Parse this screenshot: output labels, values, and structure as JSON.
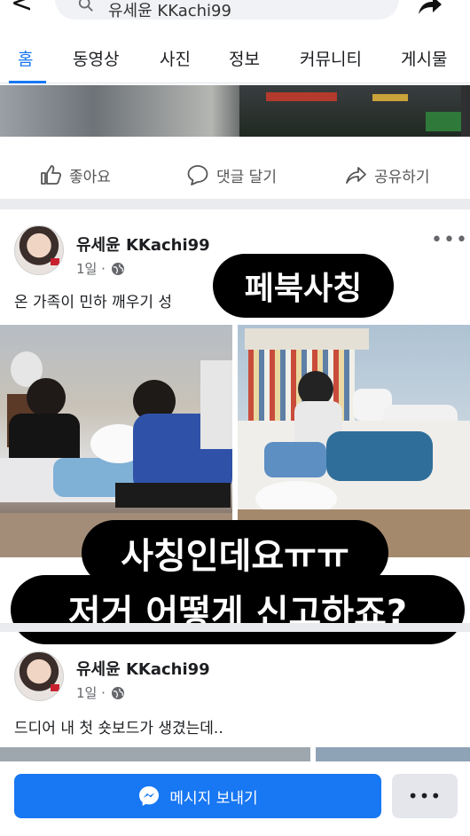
{
  "search": {
    "query": "유세윤 KKachi99"
  },
  "tabs": [
    {
      "label": "홈"
    },
    {
      "label": "동영상"
    },
    {
      "label": "사진"
    },
    {
      "label": "정보"
    },
    {
      "label": "커뮤니티"
    },
    {
      "label": "게시물"
    }
  ],
  "actions": {
    "like": "좋아요",
    "comment": "댓글 달기",
    "share": "공유하기"
  },
  "post1": {
    "author": "유세윤 KKachi99",
    "time": "1일 ·",
    "text": "온 가족이 민하 깨우기 성"
  },
  "post2": {
    "author": "유세윤 KKachi99",
    "time": "1일 ·",
    "text": "드디어 내 첫 숏보드가 생겼는데.."
  },
  "captions": {
    "top": "페북사칭",
    "middle": "사칭인데요ㅠㅠ",
    "bottom": "저거 어떻게 신고하죠?"
  },
  "message_bar": {
    "send_label": "메시지 보내기",
    "more": "•••"
  },
  "more_dots": "•••",
  "colors": {
    "accent": "#1877f2",
    "caption_bg": "#000000"
  }
}
